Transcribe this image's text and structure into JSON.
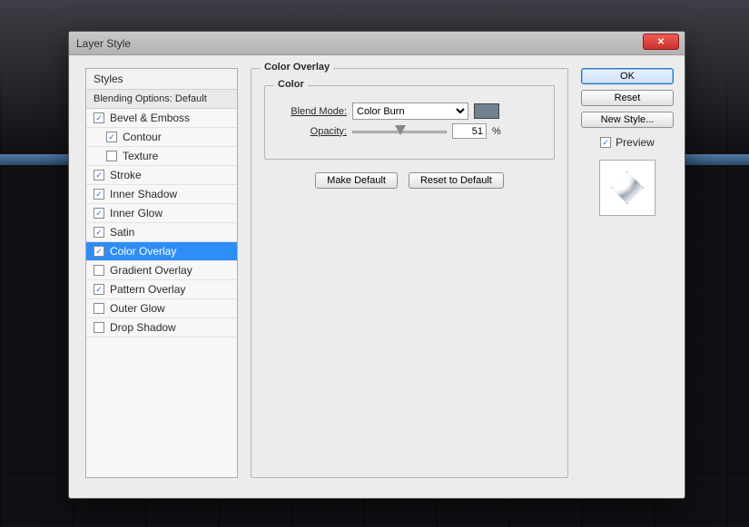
{
  "window": {
    "title": "Layer Style"
  },
  "styles_panel": {
    "header": "Styles",
    "blending_label": "Blending Options: Default",
    "items": [
      {
        "label": "Bevel & Emboss",
        "checked": true,
        "sub": false
      },
      {
        "label": "Contour",
        "checked": true,
        "sub": true
      },
      {
        "label": "Texture",
        "checked": false,
        "sub": true
      },
      {
        "label": "Stroke",
        "checked": true,
        "sub": false
      },
      {
        "label": "Inner Shadow",
        "checked": true,
        "sub": false
      },
      {
        "label": "Inner Glow",
        "checked": true,
        "sub": false
      },
      {
        "label": "Satin",
        "checked": true,
        "sub": false
      },
      {
        "label": "Color Overlay",
        "checked": true,
        "sub": false,
        "selected": true
      },
      {
        "label": "Gradient Overlay",
        "checked": false,
        "sub": false
      },
      {
        "label": "Pattern Overlay",
        "checked": true,
        "sub": false
      },
      {
        "label": "Outer Glow",
        "checked": false,
        "sub": false
      },
      {
        "label": "Drop Shadow",
        "checked": false,
        "sub": false
      }
    ]
  },
  "overlay_panel": {
    "title": "Color Overlay",
    "color_group_title": "Color",
    "blend_mode_label": "Blend Mode:",
    "blend_mode_value": "Color Burn",
    "swatch_color": "#6f8290",
    "opacity_label": "Opacity:",
    "opacity_value": "51",
    "opacity_unit": "%",
    "make_default": "Make Default",
    "reset_default": "Reset to Default"
  },
  "right": {
    "ok": "OK",
    "reset": "Reset",
    "new_style": "New Style...",
    "preview_label": "Preview",
    "preview_checked": true
  }
}
